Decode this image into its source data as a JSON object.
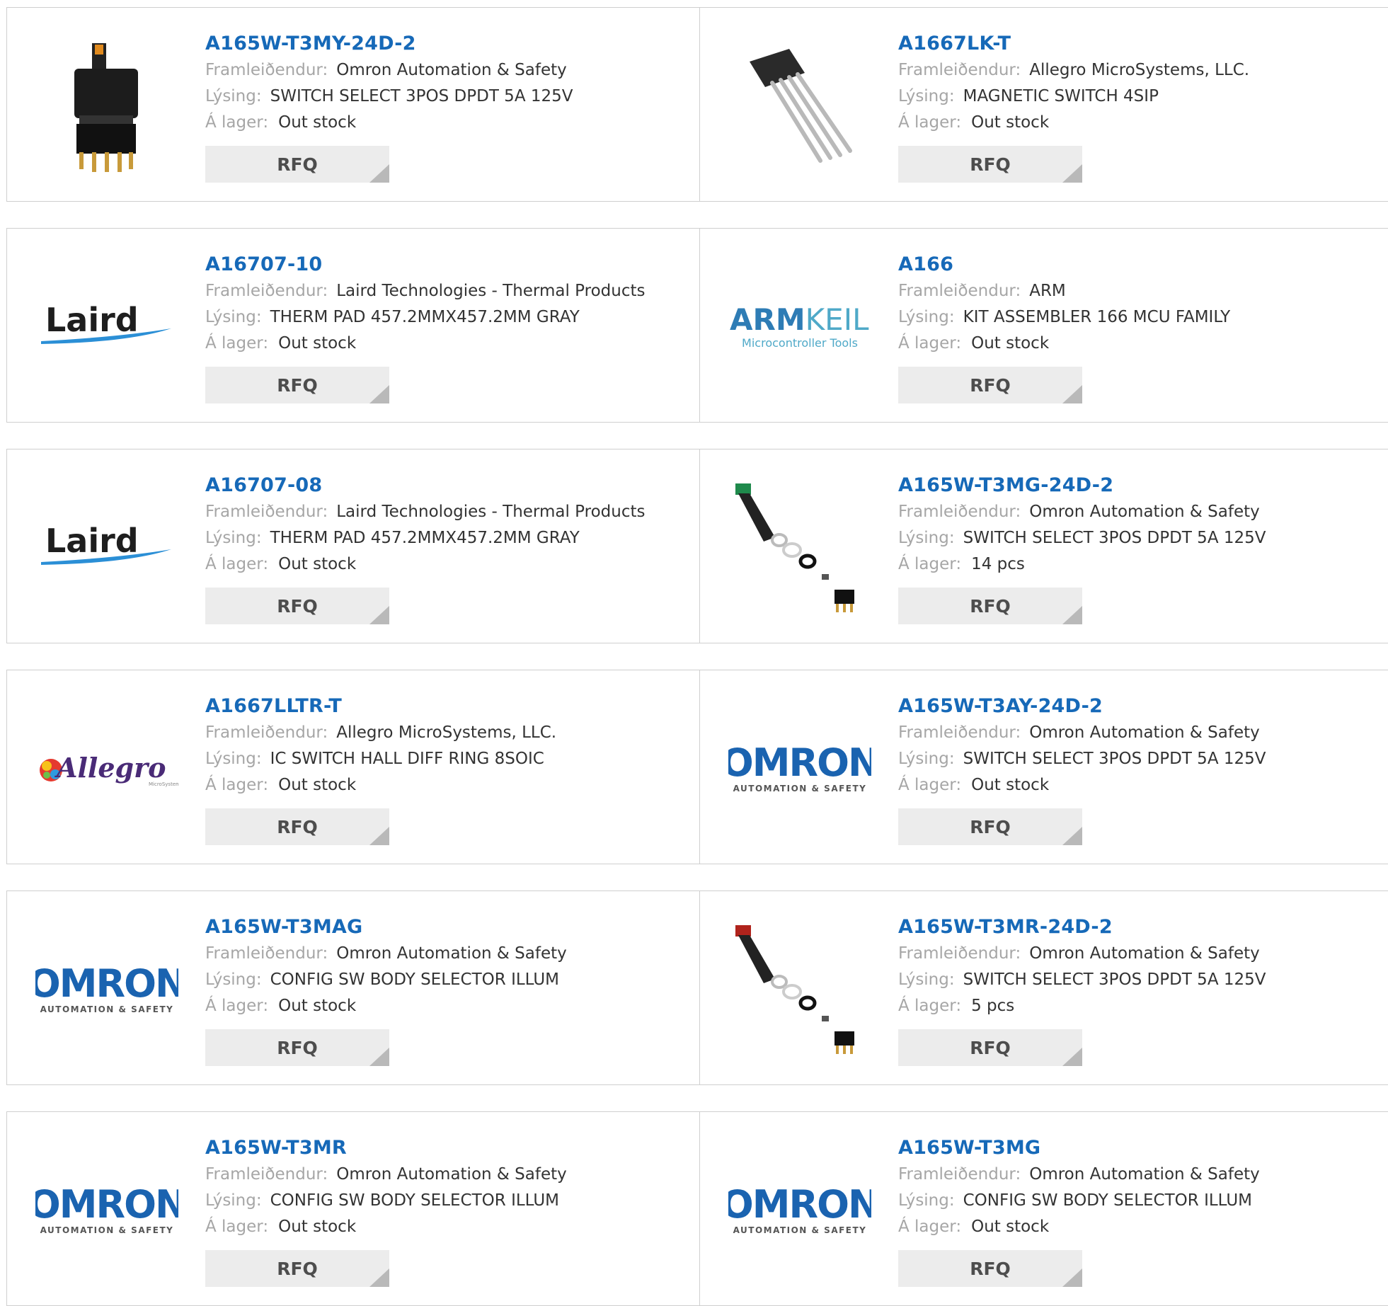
{
  "labels": {
    "manufacturer": "Framleiðendur:",
    "description": "Lýsing:",
    "stock": "Á lager:",
    "rfq": "RFQ"
  },
  "products": [
    {
      "part": "A165W-T3MY-24D-2",
      "manufacturer": "Omron Automation & Safety",
      "description": "SWITCH SELECT 3POS DPDT 5A 125V",
      "stock": "Out stock",
      "image": "selector-switch-photo"
    },
    {
      "part": "A1667LK-T",
      "manufacturer": "Allegro MicroSystems, LLC.",
      "description": "MAGNETIC SWITCH 4SIP",
      "stock": "Out stock",
      "image": "4sip-sensor-photo"
    },
    {
      "part": "A16707-10",
      "manufacturer": "Laird Technologies - Thermal Products",
      "description": "THERM PAD 457.2MMX457.2MM GRAY",
      "stock": "Out stock",
      "image": "laird-logo",
      "logo_text": "Laird"
    },
    {
      "part": "A166",
      "manufacturer": "ARM",
      "description": "KIT ASSEMBLER 166 MCU FAMILY",
      "stock": "Out stock",
      "image": "armkeil-logo",
      "logo_text": "ARMKEIL",
      "logo_sub": "Microcontroller Tools"
    },
    {
      "part": "A16707-08",
      "manufacturer": "Laird Technologies - Thermal Products",
      "description": "THERM PAD 457.2MMX457.2MM GRAY",
      "stock": "Out stock",
      "image": "laird-logo",
      "logo_text": "Laird"
    },
    {
      "part": "A165W-T3MG-24D-2",
      "manufacturer": "Omron Automation & Safety",
      "description": "SWITCH SELECT 3POS DPDT 5A 125V",
      "stock": "14 pcs",
      "image": "switch-kit-green-photo"
    },
    {
      "part": "A1667LLTR-T",
      "manufacturer": "Allegro MicroSystems, LLC.",
      "description": "IC SWITCH HALL DIFF RING 8SOIC",
      "stock": "Out stock",
      "image": "allegro-logo",
      "logo_text": "Allegro"
    },
    {
      "part": "A165W-T3AY-24D-2",
      "manufacturer": "Omron Automation & Safety",
      "description": "SWITCH SELECT 3POS DPDT 5A 125V",
      "stock": "Out stock",
      "image": "omron-logo",
      "logo_text": "OMRON",
      "logo_sub": "AUTOMATION & SAFETY"
    },
    {
      "part": "A165W-T3MAG",
      "manufacturer": "Omron Automation & Safety",
      "description": "CONFIG SW BODY SELECTOR ILLUM",
      "stock": "Out stock",
      "image": "omron-logo",
      "logo_text": "OMRON",
      "logo_sub": "AUTOMATION & SAFETY"
    },
    {
      "part": "A165W-T3MR-24D-2",
      "manufacturer": "Omron Automation & Safety",
      "description": "SWITCH SELECT 3POS DPDT 5A 125V",
      "stock": "5 pcs",
      "image": "switch-kit-red-photo"
    },
    {
      "part": "A165W-T3MR",
      "manufacturer": "Omron Automation & Safety",
      "description": "CONFIG SW BODY SELECTOR ILLUM",
      "stock": "Out stock",
      "image": "omron-logo",
      "logo_text": "OMRON",
      "logo_sub": "AUTOMATION & SAFETY"
    },
    {
      "part": "A165W-T3MG",
      "manufacturer": "Omron Automation & Safety",
      "description": "CONFIG SW BODY SELECTOR ILLUM",
      "stock": "Out stock",
      "image": "omron-logo",
      "logo_text": "OMRON",
      "logo_sub": "AUTOMATION & SAFETY"
    }
  ],
  "colors": {
    "link": "#1669b8",
    "label": "#a6a6a6",
    "border": "#cfcfcf",
    "button_bg": "#ececec",
    "omron_blue": "#1a63b0",
    "arm_blue": "#2e7cb5",
    "keil_teal": "#4fa9c8"
  }
}
